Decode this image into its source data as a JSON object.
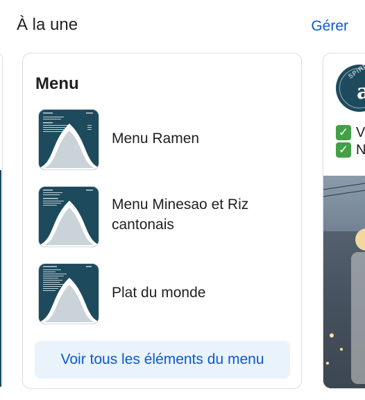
{
  "header": {
    "title": "À la une",
    "manage_label": "Gérer"
  },
  "menu_card": {
    "title": "Menu",
    "items": [
      {
        "label": "Menu Ramen"
      },
      {
        "label": "Menu Minesao et Riz cantonais"
      },
      {
        "label": "Plat du monde"
      }
    ],
    "see_all_label": "Voir tous les éléments du menu"
  },
  "right_card": {
    "logo_text": "SPIRITS",
    "logo_letter": "a",
    "checks": [
      {
        "text": "V"
      },
      {
        "text": "N"
      }
    ]
  },
  "colors": {
    "accent": "#0b57d0",
    "button_bg": "#e9f3fc",
    "thumb_bg": "#1d4b5d",
    "check_green": "#43a047"
  }
}
